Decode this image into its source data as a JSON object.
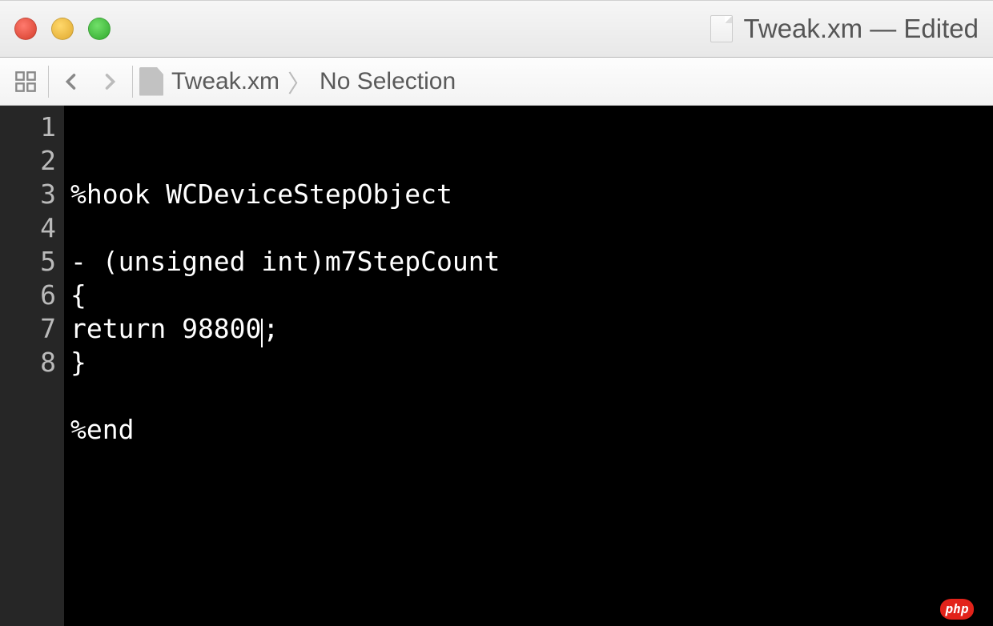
{
  "window": {
    "title_file": "Tweak.xm",
    "title_status": "— Edited"
  },
  "breadcrumb": {
    "file": "Tweak.xm",
    "selection": "No Selection"
  },
  "code": {
    "lines": [
      "%hook WCDeviceStepObject",
      "",
      "- (unsigned int)m7StepCount",
      "{",
      "return 98800;",
      "}",
      "",
      "%end"
    ],
    "cursor_line_index": 4,
    "cursor_after_text": "return 98800",
    "cursor_remainder": ";"
  },
  "gutter": {
    "start": 1,
    "end": 8
  },
  "badge": {
    "text": "php"
  }
}
